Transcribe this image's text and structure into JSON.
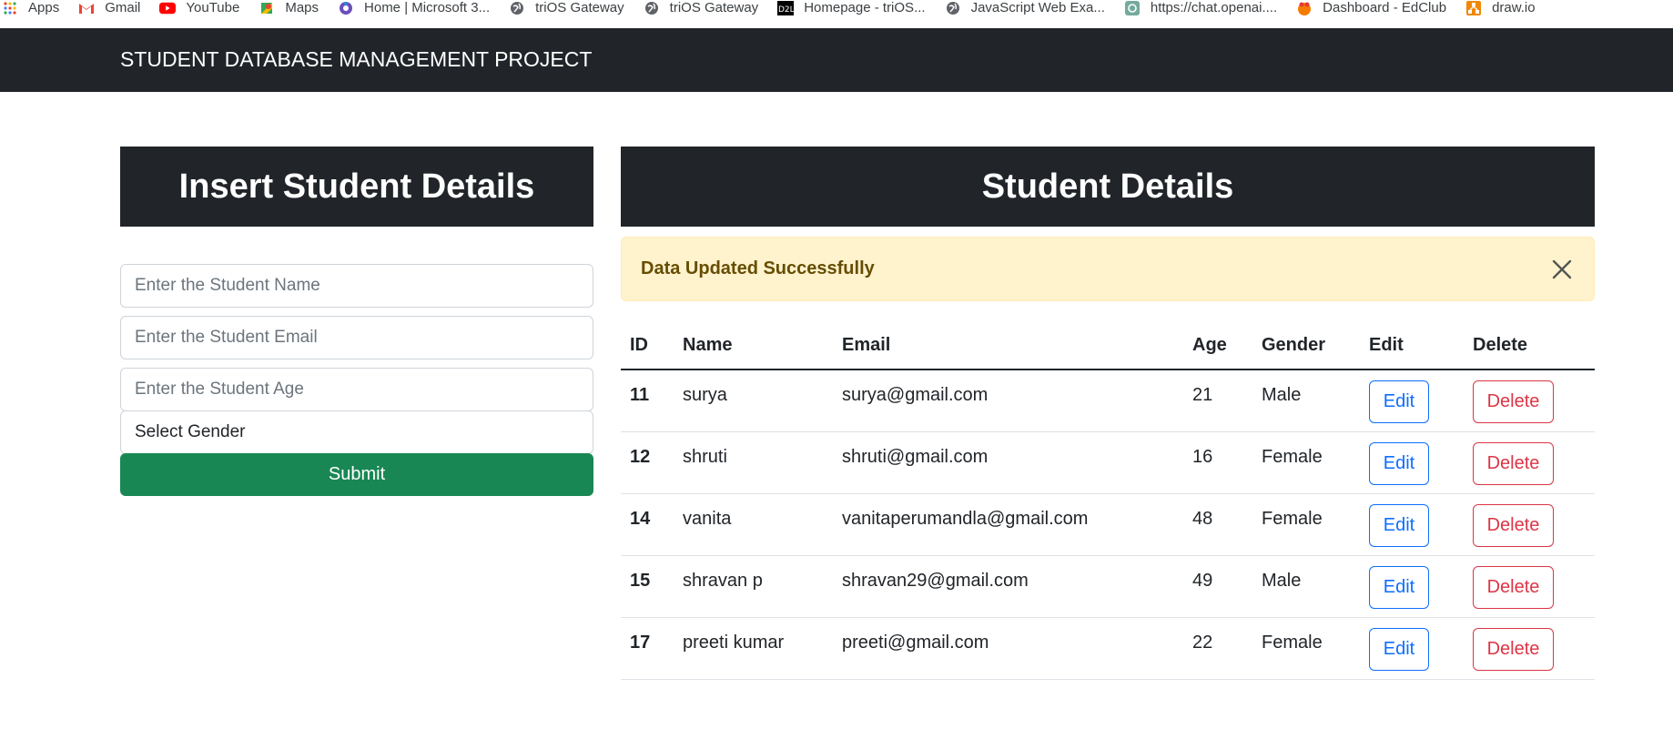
{
  "bookmarks": [
    {
      "label": "Apps",
      "icon": "apps-grid-icon"
    },
    {
      "label": "Gmail",
      "icon": "gmail-icon"
    },
    {
      "label": "YouTube",
      "icon": "youtube-icon"
    },
    {
      "label": "Maps",
      "icon": "maps-icon"
    },
    {
      "label": "Home | Microsoft 3...",
      "icon": "microsoft-icon"
    },
    {
      "label": "triOS Gateway",
      "icon": "globe-icon"
    },
    {
      "label": "triOS Gateway",
      "icon": "globe-icon"
    },
    {
      "label": "Homepage - triOS...",
      "icon": "d2l-icon"
    },
    {
      "label": "JavaScript Web Exa...",
      "icon": "globe-icon"
    },
    {
      "label": "https://chat.openai....",
      "icon": "openai-icon"
    },
    {
      "label": "Dashboard - EdClub",
      "icon": "edclub-icon"
    },
    {
      "label": "draw.io",
      "icon": "drawio-icon"
    }
  ],
  "navbar": {
    "brand": "STUDENT DATABASE MANAGEMENT PROJECT"
  },
  "insert_panel": {
    "title": "Insert Student Details",
    "name_placeholder": "Enter the Student Name",
    "email_placeholder": "Enter the Student Email",
    "age_placeholder": "Enter the Student Age",
    "gender_select": "Select Gender",
    "submit_label": "Submit"
  },
  "details_panel": {
    "title": "Student Details",
    "alert": "Data Updated Successfully",
    "columns": [
      "ID",
      "Name",
      "Email",
      "Age",
      "Gender",
      "Edit",
      "Delete"
    ],
    "edit_label": "Edit",
    "delete_label": "Delete",
    "rows": [
      {
        "id": "11",
        "name": "surya",
        "email": "surya@gmail.com",
        "age": "21",
        "gender": "Male"
      },
      {
        "id": "12",
        "name": "shruti",
        "email": "shruti@gmail.com",
        "age": "16",
        "gender": "Female"
      },
      {
        "id": "14",
        "name": "vanita",
        "email": "vanitaperumandla@gmail.com",
        "age": "48",
        "gender": "Female"
      },
      {
        "id": "15",
        "name": "shravan p",
        "email": "shravan29@gmail.com",
        "age": "49",
        "gender": "Male"
      },
      {
        "id": "17",
        "name": "preeti kumar",
        "email": "preeti@gmail.com",
        "age": "22",
        "gender": "Female"
      }
    ]
  },
  "colors": {
    "dark": "#212529",
    "success": "#198754",
    "primary": "#0d6efd",
    "danger": "#dc3545",
    "warning_bg": "#fff3cd",
    "warning_text": "#664d03"
  }
}
